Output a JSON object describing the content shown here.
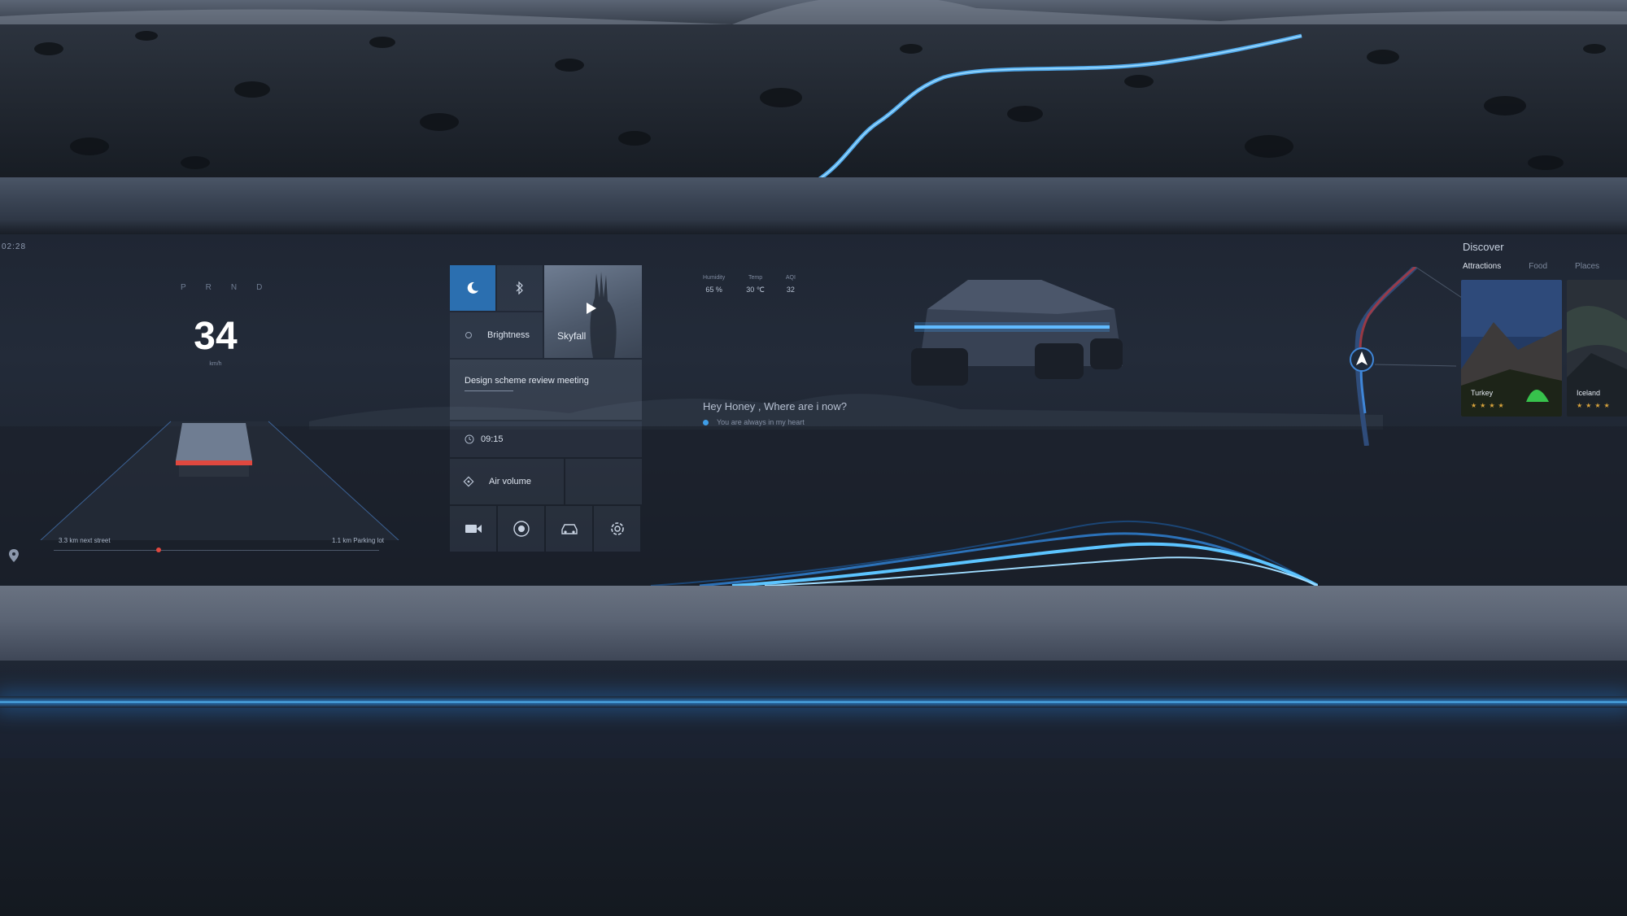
{
  "colors": {
    "accent": "#2b6fb0",
    "glow": "#3fa6ff",
    "tail_light": "#e0483f",
    "star": "#d9a43c"
  },
  "clock": "02:28",
  "cluster": {
    "gears": [
      "P",
      "R",
      "N",
      "D"
    ],
    "speed": "34",
    "speed_unit": "km/h",
    "route_left": "3.3 km next street",
    "route_right": "1.1 km Parking lot"
  },
  "controls": {
    "moon_icon": "moon-icon",
    "bluetooth_icon": "bluetooth-icon",
    "brightness_label": "Brightness",
    "media_title": "Skyfall",
    "meeting_title": "Design scheme review meeting",
    "meeting_time": "09:15",
    "air_volume_label": "Air volume",
    "buttons": [
      "camera-icon",
      "target-icon",
      "car-icon",
      "settings-icon"
    ]
  },
  "stats": [
    {
      "label": "Humidity",
      "value": "65 %"
    },
    {
      "label": "Temp",
      "value": "30 ℃"
    },
    {
      "label": "AQI",
      "value": "32"
    }
  ],
  "assistant": {
    "question": "Hey Honey , Where are i now?",
    "answer": "You are always in my heart"
  },
  "discover": {
    "title": "Discover",
    "tabs": [
      "Attractions",
      "Food",
      "Places"
    ],
    "active_tab": "Attractions",
    "cards": [
      {
        "name": "Turkey",
        "stars": "★★★★"
      },
      {
        "name": "Iceland",
        "stars": "★★★★"
      }
    ]
  }
}
